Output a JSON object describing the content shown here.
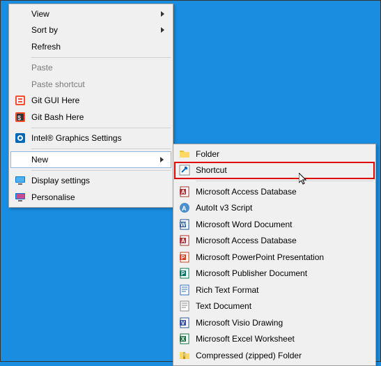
{
  "primary": {
    "view": "View",
    "sort": "Sort by",
    "refresh": "Refresh",
    "paste": "Paste",
    "paste_shortcut": "Paste shortcut",
    "git_gui": "Git GUI Here",
    "git_bash": "Git Bash Here",
    "intel": "Intel® Graphics Settings",
    "new": "New",
    "display": "Display settings",
    "personalise": "Personalise"
  },
  "secondary": {
    "folder": "Folder",
    "shortcut": "Shortcut",
    "access1": "Microsoft Access Database",
    "autoit": "AutoIt v3 Script",
    "word": "Microsoft Word Document",
    "access2": "Microsoft Access Database",
    "ppt": "Microsoft PowerPoint Presentation",
    "publisher": "Microsoft Publisher Document",
    "rtf": "Rich Text Format",
    "txt": "Text Document",
    "visio": "Microsoft Visio Drawing",
    "excel": "Microsoft Excel Worksheet",
    "zip": "Compressed (zipped) Folder"
  }
}
